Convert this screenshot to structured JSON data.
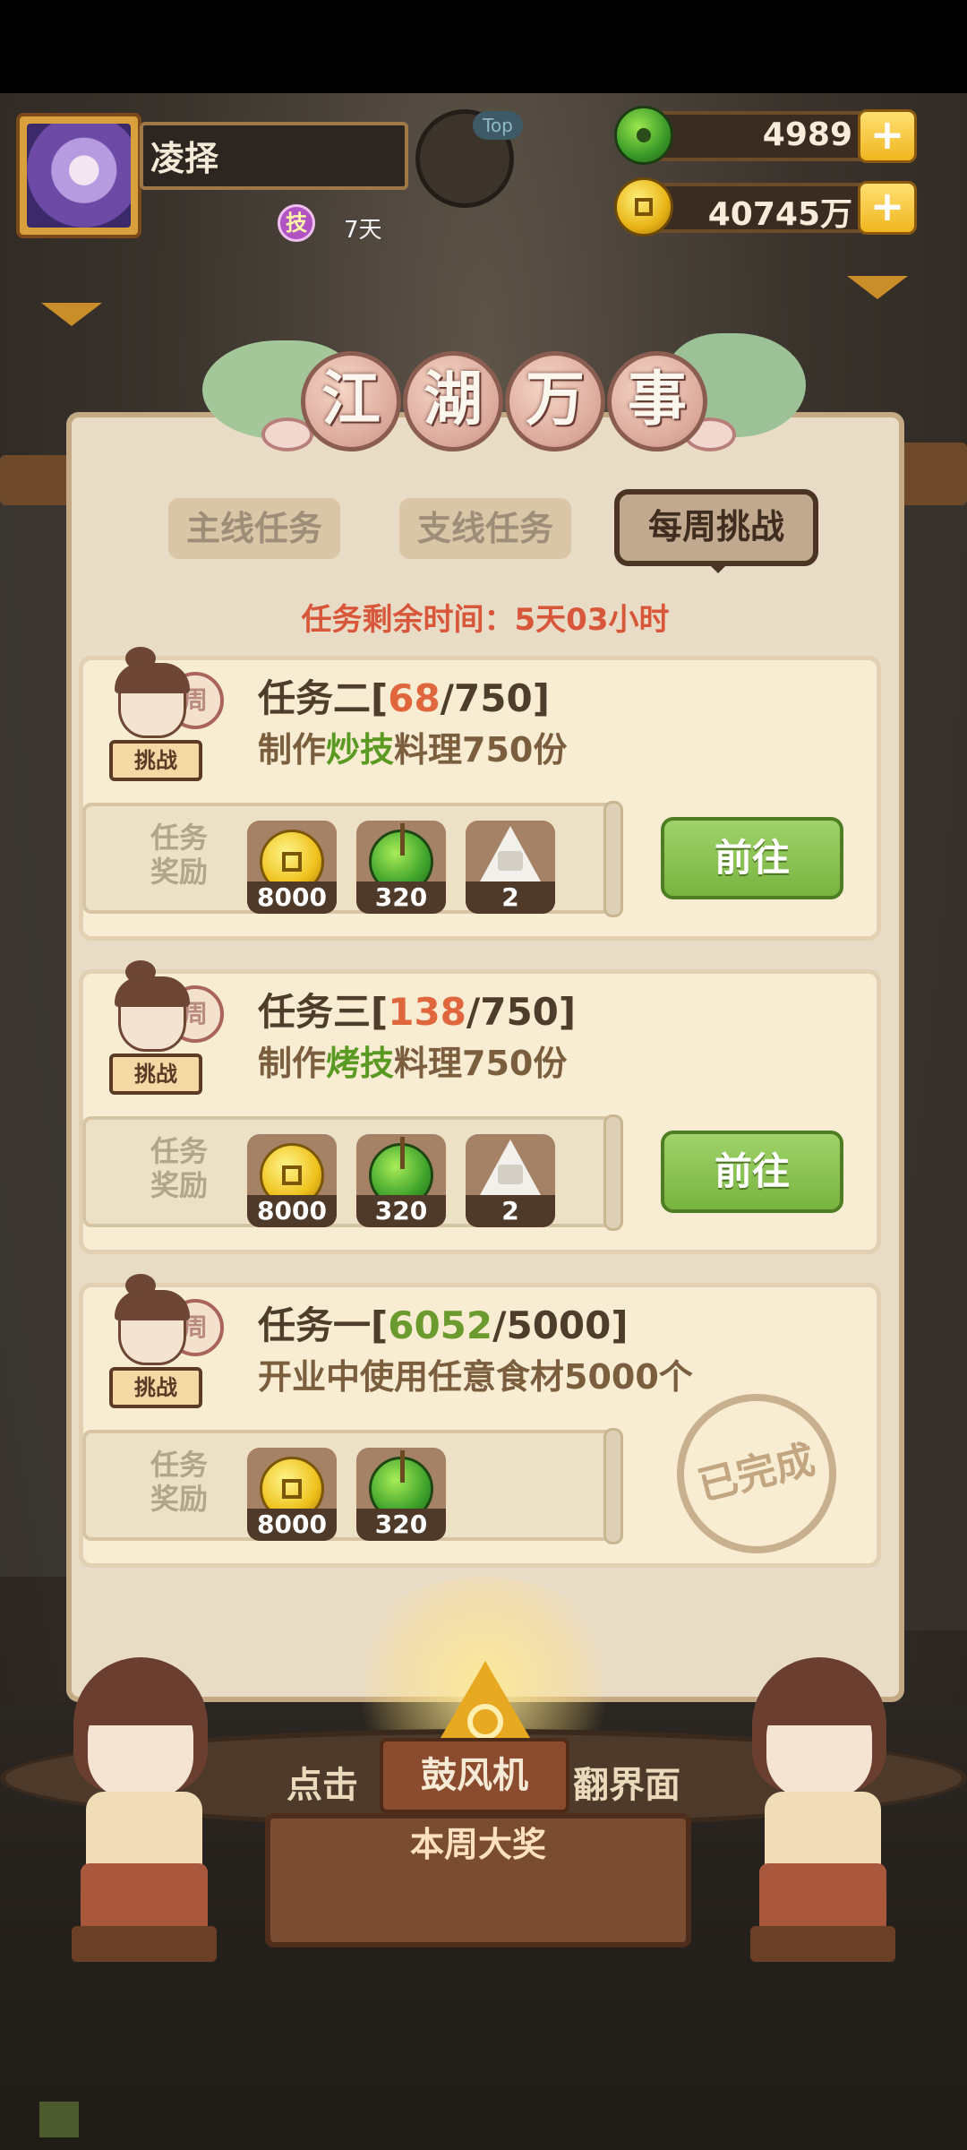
{
  "player": {
    "name": "凌择",
    "skill_badge": "技",
    "skill_days": "7天",
    "fav_badge": "Top"
  },
  "currency": {
    "jade": {
      "icon": "jade-icon",
      "value": "4989"
    },
    "coins": {
      "icon": "coin-icon",
      "value": "40745万"
    },
    "plus_label": "+"
  },
  "panel": {
    "title_chars": [
      "江",
      "湖",
      "万",
      "事"
    ],
    "tabs": [
      {
        "label": "主线任务",
        "active": false
      },
      {
        "label": "支线任务",
        "active": false
      },
      {
        "label": "每周挑战",
        "active": true
      }
    ],
    "timer_text": "任务剩余时间：5天03小时"
  },
  "character": {
    "drum_label": "周",
    "tag_label": "挑战"
  },
  "reward_label_line1": "任务",
  "reward_label_line2": "奖励",
  "tasks": [
    {
      "name": "任务二",
      "progress": "68",
      "progress_color": "red",
      "goal": "750",
      "desc_pre": "制作",
      "desc_hl": "炒技",
      "desc_post": "料理750份",
      "rewards": [
        {
          "icon": "coin-icon",
          "count": "8000"
        },
        {
          "icon": "jade-icon",
          "count": "320"
        },
        {
          "icon": "onigiri-icon",
          "count": "2"
        }
      ],
      "action": "前往",
      "completed": false
    },
    {
      "name": "任务三",
      "progress": "138",
      "progress_color": "red",
      "goal": "750",
      "desc_pre": "制作",
      "desc_hl": "烤技",
      "desc_post": "料理750份",
      "rewards": [
        {
          "icon": "coin-icon",
          "count": "8000"
        },
        {
          "icon": "jade-icon",
          "count": "320"
        },
        {
          "icon": "onigiri-icon",
          "count": "2"
        }
      ],
      "action": "前往",
      "completed": false
    },
    {
      "name": "任务一",
      "progress": "6052",
      "progress_color": "green",
      "goal": "5000",
      "desc_pre": "开业中使用任意食材5000个",
      "desc_hl": "",
      "desc_post": "",
      "rewards": [
        {
          "icon": "coin-icon",
          "count": "8000"
        },
        {
          "icon": "jade-icon",
          "count": "320"
        }
      ],
      "stamp": "已完成",
      "completed": true
    }
  ],
  "weekly_prize": {
    "hint_left": "点击",
    "hint_right": "翻界面",
    "item_name": "鼓风机",
    "label": "本周大奖"
  },
  "colors": {
    "accent_red": "#e0673d",
    "accent_green": "#6b9b2e",
    "go_button": "#86c24e",
    "panel_bg": "#e9dcc6"
  }
}
